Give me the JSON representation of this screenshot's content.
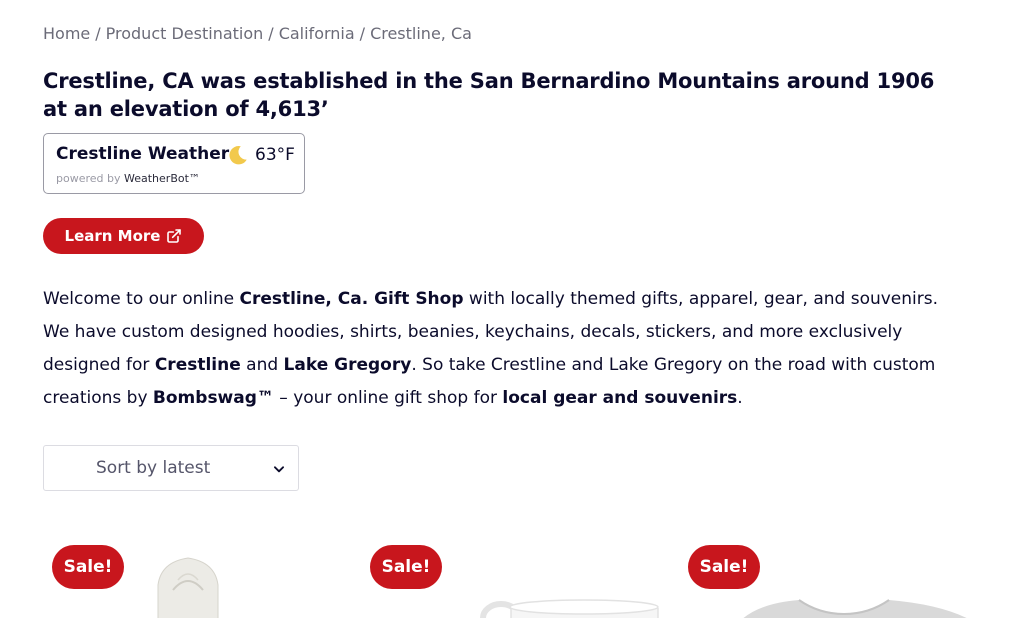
{
  "breadcrumb": {
    "items": [
      {
        "label": "Home"
      },
      {
        "label": "Product Destination"
      },
      {
        "label": "California"
      },
      {
        "label": "Crestline, Ca"
      }
    ],
    "separator": "/"
  },
  "page_title": "Crestline, CA was established in the San Bernardino Mountains around 1906 at an elevation of 4,613’",
  "weather": {
    "title": "Crestline Weather",
    "icon": "moon-icon",
    "temperature": "63°F",
    "powered_by_prefix": "powered by",
    "powered_by_brand": "WeatherBot™"
  },
  "learn_more": {
    "label": "Learn More",
    "icon": "external-link-icon"
  },
  "intro": {
    "t1": "Welcome to our online ",
    "b1": "Crestline, Ca. Gift Shop",
    "t2": " with locally themed gifts, apparel, gear, and souvenirs. We have custom designed hoodies, shirts, beanies, keychains, decals, stickers, and more exclusively designed for ",
    "b2": "Crestline",
    "t3": " and ",
    "b3": "Lake Gregory",
    "t4": ". So take Crestline and Lake Gregory on the road with custom creations by ",
    "b4": "Bombswag™",
    "t5": " – your online gift shop for ",
    "b5": "local gear and souvenirs",
    "t6": "."
  },
  "sort": {
    "selected": "Sort by latest",
    "icon": "chevron-down-icon"
  },
  "products": [
    {
      "badge": "Sale!",
      "image": "hoodie"
    },
    {
      "badge": "Sale!",
      "image": "mug"
    },
    {
      "badge": "Sale!",
      "image": "sweatshirt"
    }
  ],
  "colors": {
    "accent": "#c8161d",
    "text": "#0b0b2b",
    "muted": "#6b6b78",
    "moon": "#f2c94c"
  }
}
